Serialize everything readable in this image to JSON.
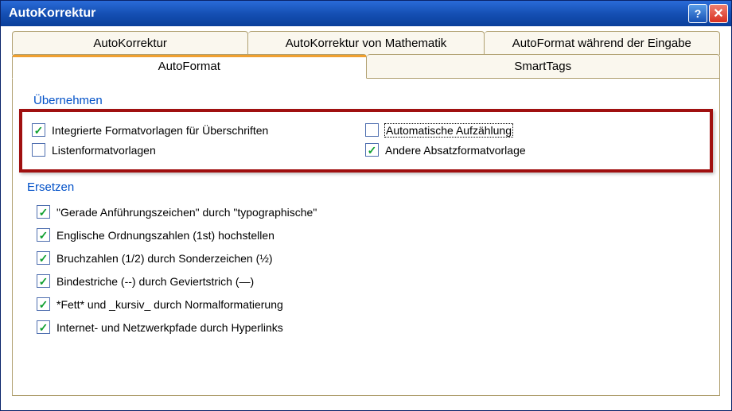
{
  "window": {
    "title": "AutoKorrektur"
  },
  "tabs": {
    "top": [
      {
        "label": "AutoKorrektur"
      },
      {
        "label": "AutoKorrektur von Mathematik"
      },
      {
        "label": "AutoFormat während der Eingabe"
      }
    ],
    "second": [
      {
        "label": "AutoFormat"
      },
      {
        "label": "SmartTags"
      }
    ]
  },
  "groups": {
    "uebernehmen": {
      "title": "Übernehmen",
      "items": [
        {
          "checked": true,
          "text": "Integrierte Formatvorlagen für Überschriften"
        },
        {
          "checked": false,
          "text": "Automatische Aufzählung",
          "focused": true
        },
        {
          "checked": false,
          "text": "Listenformatvorlagen"
        },
        {
          "checked": true,
          "text": "Andere Absatzformatvorlage"
        }
      ]
    },
    "ersetzen": {
      "title": "Ersetzen",
      "items": [
        {
          "checked": true,
          "text": "\"Gerade Anführungszeichen\" durch \"typographische\""
        },
        {
          "checked": true,
          "text": "Englische Ordnungszahlen (1st) hochstellen"
        },
        {
          "checked": true,
          "text": "Bruchzahlen (1/2) durch Sonderzeichen (½)"
        },
        {
          "checked": true,
          "text": "Bindestriche (--) durch Geviertstrich (—)"
        },
        {
          "checked": true,
          "text": "*Fett* und _kursiv_ durch Normalformatierung"
        },
        {
          "checked": true,
          "text": "Internet- und Netzwerkpfade durch Hyperlinks"
        }
      ]
    }
  }
}
